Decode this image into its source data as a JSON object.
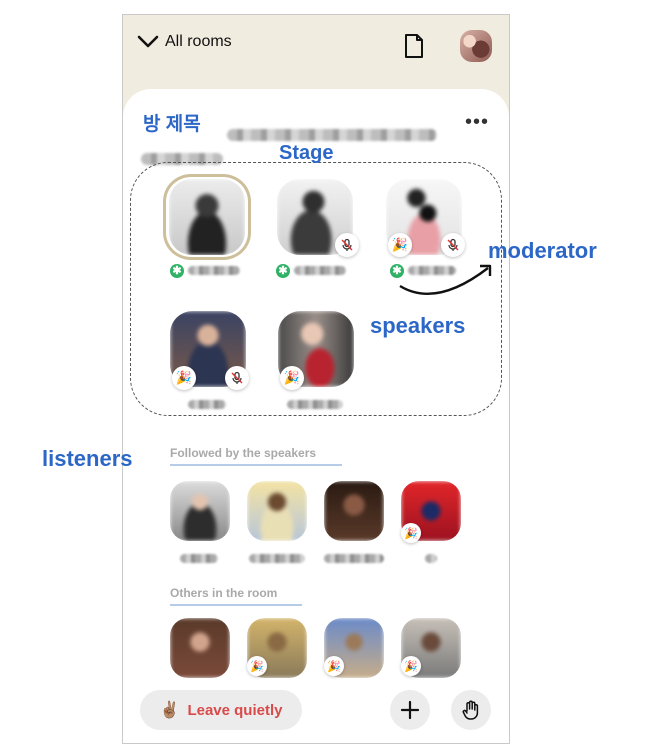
{
  "topbar": {
    "back_label": "All rooms",
    "back_icon": "chevron-down-icon",
    "doc_icon": "document-icon"
  },
  "room": {
    "title": "방 제목"
  },
  "annotations": {
    "stage": "Stage",
    "moderator": "moderator",
    "speakers": "speakers",
    "listeners": "listeners"
  },
  "sections": {
    "followed": "Followed by the speakers",
    "others": "Others in the room"
  },
  "bottom": {
    "leave_label": "Leave quietly",
    "leave_emoji": "✌🏽",
    "add_icon": "plus-icon",
    "raise_hand_icon": "raise-hand-icon"
  },
  "colors": {
    "accent_blue": "#2c67c7",
    "leave_red": "#d94a4a",
    "moderator_green": "#2fb166",
    "header_bg": "#f1ece0"
  }
}
